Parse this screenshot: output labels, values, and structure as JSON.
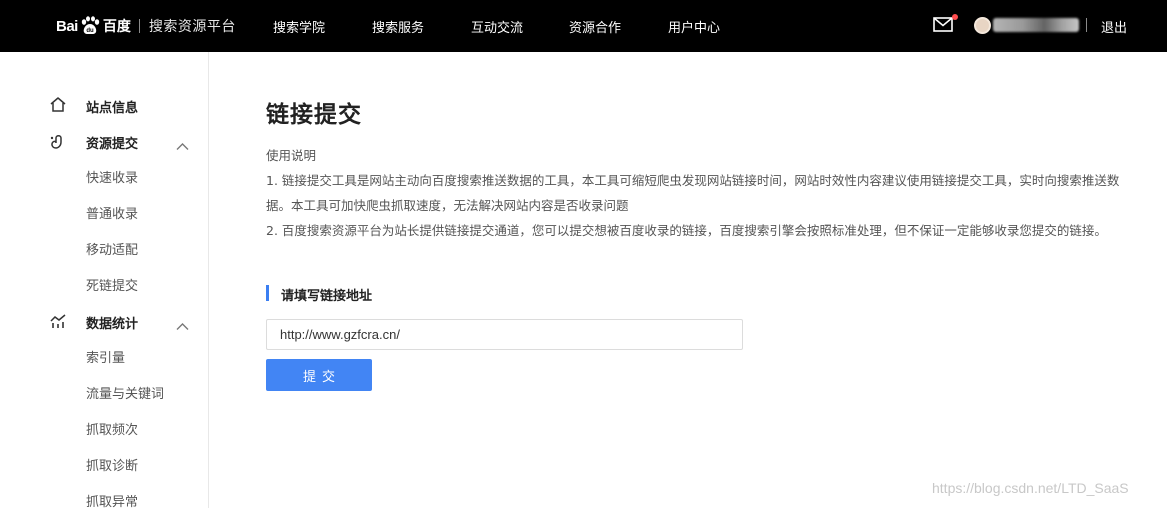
{
  "header": {
    "logo": {
      "bai": "Bai",
      "baidu": "百度",
      "platform": "搜索资源平台"
    },
    "nav": [
      "搜索学院",
      "搜索服务",
      "互动交流",
      "资源合作",
      "用户中心"
    ],
    "logout": "退出"
  },
  "sidebar": {
    "station_info": "站点信息",
    "resource_submit": {
      "label": "资源提交",
      "expanded": true,
      "items": [
        "快速收录",
        "普通收录",
        "移动适配",
        "死链提交"
      ]
    },
    "data_stats": {
      "label": "数据统计",
      "expanded": true,
      "items": [
        "索引量",
        "流量与关键词",
        "抓取频次",
        "抓取诊断",
        "抓取异常"
      ]
    }
  },
  "main": {
    "title": "链接提交",
    "instructions": {
      "heading": "使用说明",
      "line1": "1. 链接提交工具是网站主动向百度搜索推送数据的工具，本工具可缩短爬虫发现网站链接时间，网站时效性内容建议使用链接提交工具，实时向搜索推送数",
      "line1b": "据。本工具可加快爬虫抓取速度，无法解决网站内容是否收录问题",
      "line2": "2. 百度搜索资源平台为站长提供链接提交通道，您可以提交想被百度收录的链接，百度搜索引擎会按照标准处理，但不保证一定能够收录您提交的链接。"
    },
    "section_title": "请填写链接地址",
    "url_value": "http://www.gzfcra.cn/",
    "submit_label": "提交"
  },
  "watermark": "https://blog.csdn.net/LTD_SaaS",
  "colors": {
    "topbar": "#000000",
    "accent": "#4285f4",
    "section_bar": "#3b7ff2",
    "notification_dot": "#ff4d4f"
  }
}
